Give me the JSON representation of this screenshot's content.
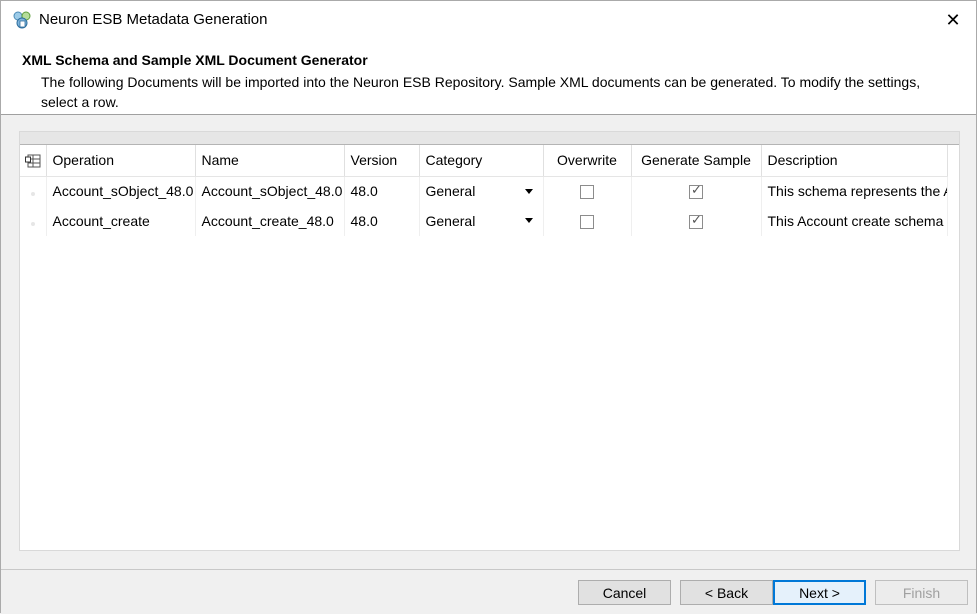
{
  "window": {
    "title": "Neuron ESB Metadata Generation",
    "close_glyph": "✕"
  },
  "header": {
    "title": "XML Schema and Sample XML Document Generator",
    "description": "The following Documents will be imported into the Neuron ESB Repository. Sample XML documents can be generated. To modify the settings, select a row."
  },
  "grid": {
    "columns": [
      "Operation",
      "Name",
      "Version",
      "Category",
      "Overwrite",
      "Generate Sample",
      "Description"
    ],
    "rows": [
      {
        "operation": "Account_sObject_48.0",
        "name": "Account_sObject_48.0",
        "version": "48.0",
        "category": "General",
        "overwrite": false,
        "generate_sample": true,
        "description": "This schema represents the Account sObject"
      },
      {
        "operation": "Account_create",
        "name": "Account_create_48.0",
        "version": "48.0",
        "category": "General",
        "overwrite": false,
        "generate_sample": true,
        "description": "This Account create schema was generated"
      }
    ]
  },
  "footer": {
    "cancel_label": "Cancel",
    "back_label": "< Back",
    "next_label": "Next >",
    "finish_label": "Finish"
  },
  "colors": {
    "primary_button_border": "#0078d7",
    "disabled_text": "#a0a0a0"
  }
}
